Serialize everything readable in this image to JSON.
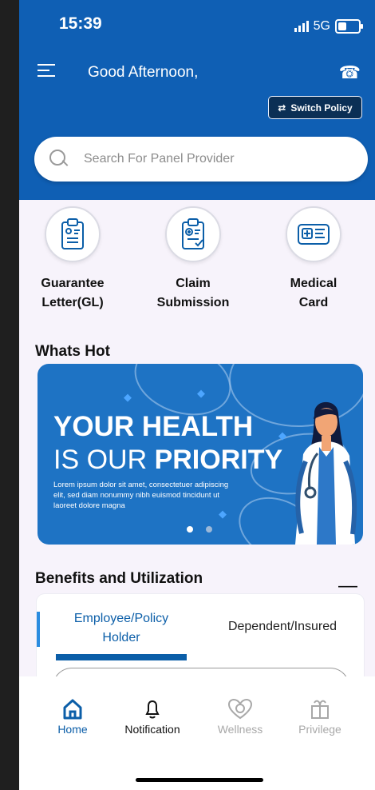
{
  "status": {
    "time": "15:39",
    "network": "5G"
  },
  "header": {
    "greeting": "Good Afternoon,",
    "switch_policy": "Switch Policy"
  },
  "search": {
    "placeholder": "Search For Panel Provider"
  },
  "quick_actions": [
    {
      "line1": "Guarantee",
      "line2": "Letter(GL)",
      "icon": "guarantee-letter-icon"
    },
    {
      "line1": "Claim",
      "line2": "Submission",
      "icon": "claim-submission-icon"
    },
    {
      "line1": "Medical",
      "line2": "Card",
      "icon": "medical-card-icon"
    }
  ],
  "whats_hot": {
    "title": "Whats Hot",
    "banner": {
      "headline1": "YOUR HEALTH",
      "headline2a": "IS OUR",
      "headline2b": "PRIORITY",
      "copy": "Lorem ipsum dolor sit amet, consectetuer adipiscing elit, sed diam nonummy nibh euismod tincidunt ut laoreet dolore magna"
    },
    "carousel_active": 1,
    "carousel_count": 2
  },
  "benefits": {
    "title": "Benefits and Utilization",
    "collapse": "—",
    "tabs": [
      {
        "line1": "Employee/Policy",
        "line2": "Holder"
      },
      {
        "label": "Dependent/Insured"
      }
    ]
  },
  "bottom_nav": [
    {
      "label": "Home",
      "icon": "home-icon",
      "color": "#0b5ea8"
    },
    {
      "label": "Notification",
      "icon": "bell-icon",
      "color": "#111111"
    },
    {
      "label": "Wellness",
      "icon": "heart-icon",
      "color": "#a8a8a8"
    },
    {
      "label": "Privilege",
      "icon": "gift-icon",
      "color": "#a8a8a8"
    }
  ],
  "colors": {
    "primary": "#0f5fb4",
    "accent": "#2b8ce0",
    "banner": "#1e73c4"
  }
}
